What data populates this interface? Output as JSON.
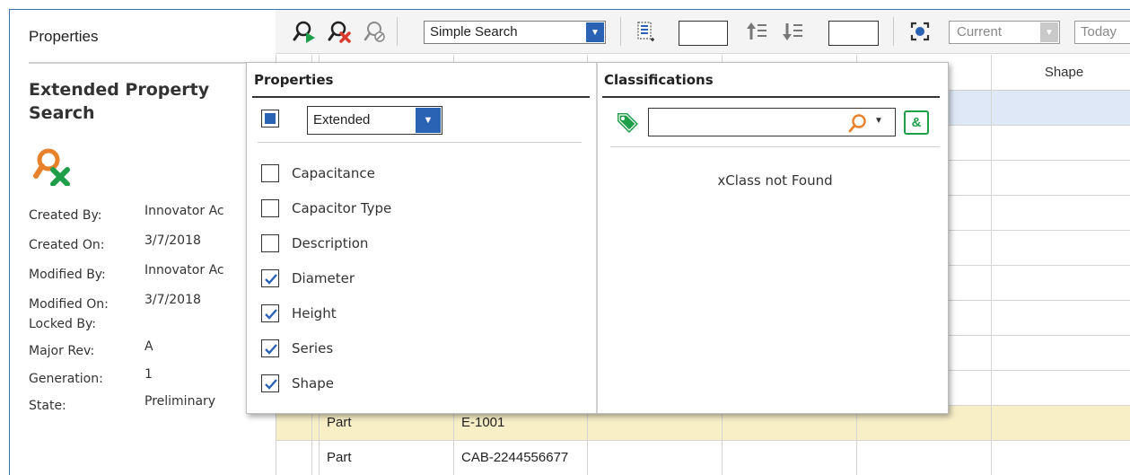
{
  "left_panel": {
    "header": "Properties",
    "item_title": "Extended Property Search",
    "item_icon": "search-item-icon",
    "metadata": [
      {
        "label": "Created By:",
        "value": "Innovator Ac"
      },
      {
        "label": "Created On:",
        "value": "3/7/2018"
      },
      {
        "label": "Modified By:",
        "value": "Innovator Ac"
      },
      {
        "label": "Modified On:",
        "value": "3/7/2018"
      },
      {
        "label": "Locked By:",
        "value": ""
      },
      {
        "label": "Major Rev:",
        "value": "A"
      },
      {
        "label": "Generation:",
        "value": "1"
      },
      {
        "label": "State:",
        "value": "Preliminary"
      }
    ]
  },
  "toolbar": {
    "search_mode": "Simple Search",
    "current_label": "Current",
    "today_label": "Today",
    "icons": [
      "run-search-icon",
      "clear-search-icon",
      "disabled-search-icon",
      "select-page-icon",
      "move-up-icon",
      "move-down-icon",
      "focus-icon"
    ]
  },
  "grid": {
    "columns": [
      "",
      "",
      "",
      "",
      "",
      "Shape"
    ],
    "rows": [
      {
        "type": "",
        "number": "",
        "state": "selected"
      },
      {
        "type": "",
        "number": "",
        "state": ""
      },
      {
        "type": "",
        "number": "",
        "state": ""
      },
      {
        "type": "",
        "number": "",
        "state": ""
      },
      {
        "type": "",
        "number": "",
        "state": ""
      },
      {
        "type": "",
        "number": "",
        "state": ""
      },
      {
        "type": "",
        "number": "",
        "state": ""
      },
      {
        "type": "",
        "number": "",
        "state": ""
      },
      {
        "type": "",
        "number": "",
        "state": ""
      },
      {
        "type": "Part",
        "number": "E-1001",
        "state": "highlighted"
      },
      {
        "type": "Part",
        "number": "CAB-2244556677",
        "state": ""
      }
    ]
  },
  "popup": {
    "properties_title": "Properties",
    "classifications_title": "Classifications",
    "property_set": "Extended",
    "properties": [
      {
        "label": "Capacitance",
        "checked": false
      },
      {
        "label": "Capacitor Type",
        "checked": false
      },
      {
        "label": "Description",
        "checked": false
      },
      {
        "label": "Diameter",
        "checked": true
      },
      {
        "label": "Height",
        "checked": true
      },
      {
        "label": "Series",
        "checked": true
      },
      {
        "label": "Shape",
        "checked": true
      }
    ],
    "class_search_value": "",
    "and_button": "&",
    "not_found_text": "xClass not Found"
  },
  "colors": {
    "accent": "#2a62b4",
    "selected_row": "#dfe8f6",
    "highlight_row": "#f8efc7",
    "tag_green": "#1f9e4a",
    "search_orange": "#e8822a"
  }
}
